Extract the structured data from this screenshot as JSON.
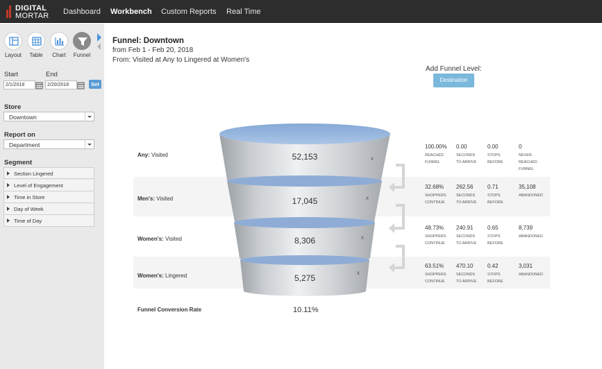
{
  "brand": {
    "line1": "DIGITAL",
    "line2": "MORTAR"
  },
  "nav": [
    "Dashboard",
    "Workbench",
    "Custom Reports",
    "Real Time"
  ],
  "toolbar": [
    {
      "label": "Layout",
      "icon": "layout-icon"
    },
    {
      "label": "Table",
      "icon": "table-icon"
    },
    {
      "label": "Chart",
      "icon": "chart-icon"
    },
    {
      "label": "Funnel",
      "icon": "funnel-icon"
    }
  ],
  "dates": {
    "start_label": "Start",
    "end_label": "End",
    "start_value": "2/1/2018",
    "end_value": "2/20/2018",
    "set_label": "Set"
  },
  "store": {
    "label": "Store",
    "value": "Downtown"
  },
  "report_on": {
    "label": "Report on",
    "value": "Department"
  },
  "segment": {
    "label": "Segment",
    "items": [
      "Section Lingered",
      "Level of Engagement",
      "Time in Store",
      "Day of Week",
      "Time of Day"
    ]
  },
  "funnel": {
    "title": "Funnel: Downtown",
    "date_range": "from Feb 1 - Feb 20, 2018",
    "path": "From: Visited at Any to Lingered at Women's",
    "add_level_label": "Add Funnel Level:",
    "destination_label": "Destination",
    "remove_glyph": "x",
    "levels": [
      {
        "name": "Any:",
        "action": "Visited",
        "value": "52,153",
        "stats": [
          {
            "value": "100.00%",
            "caption": [
              "REACHED",
              "FUNNEL"
            ]
          },
          {
            "value": "0.00",
            "caption": [
              "SECONDS",
              "TO ARRIVE"
            ]
          },
          {
            "value": "0.00",
            "caption": [
              "STOPS",
              "BEFORE"
            ]
          },
          {
            "value": "0",
            "caption": [
              "NEVER",
              "REACHED",
              "FUNNEL"
            ]
          }
        ]
      },
      {
        "name": "Men's:",
        "action": "Visited",
        "value": "17,045",
        "stats": [
          {
            "value": "32.68%",
            "caption": [
              "SHOPPERS",
              "CONTINUE"
            ]
          },
          {
            "value": "262.56",
            "caption": [
              "SECONDS",
              "TO ARRIVE"
            ]
          },
          {
            "value": "0.71",
            "caption": [
              "STOPS",
              "BEFORE"
            ]
          },
          {
            "value": "35,108",
            "caption": [
              "ABANDONED"
            ]
          }
        ]
      },
      {
        "name": "Women's:",
        "action": "Visited",
        "value": "8,306",
        "stats": [
          {
            "value": "48.73%",
            "caption": [
              "SHOPPERS",
              "CONTINUE"
            ]
          },
          {
            "value": "240.91",
            "caption": [
              "SECONDS",
              "TO ARRIVE"
            ]
          },
          {
            "value": "0.65",
            "caption": [
              "STOPS",
              "BEFORE"
            ]
          },
          {
            "value": "8,739",
            "caption": [
              "ABANDONED"
            ]
          }
        ]
      },
      {
        "name": "Women's:",
        "action": "Lingered",
        "value": "5,275",
        "stats": [
          {
            "value": "63.51%",
            "caption": [
              "SHOPPERS",
              "CONTINUE"
            ]
          },
          {
            "value": "470.10",
            "caption": [
              "SECONDS",
              "TO ARRIVE"
            ]
          },
          {
            "value": "0.42",
            "caption": [
              "STOPS",
              "BEFORE"
            ]
          },
          {
            "value": "3,031",
            "caption": [
              "ABANDONED"
            ]
          }
        ]
      }
    ],
    "conversion_label": "Funnel Conversion Rate",
    "conversion_value": "10.11%"
  },
  "colors": {
    "accent": "#5a9bd5",
    "topbar": "#2d2d2d",
    "sidebar": "#e9e9e9",
    "funnel_top": "#8fb4e3",
    "brand_red": "#c0392b"
  }
}
